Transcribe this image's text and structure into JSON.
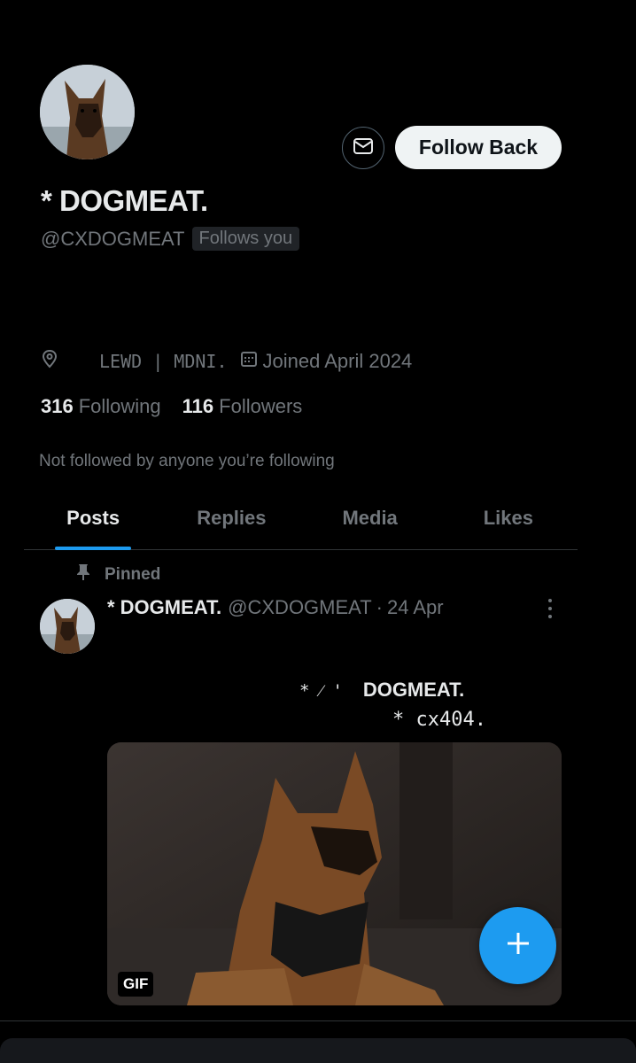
{
  "profile": {
    "display_name": "* DOGMEAT.",
    "handle": "@CXDOGMEAT",
    "follows_you": "Follows you",
    "location": "LEWD | MDNI.",
    "joined": "Joined April 2024",
    "following_count": "316",
    "following_label": "Following",
    "followers_count": "116",
    "followers_label": "Followers",
    "not_followed_text": "Not followed by anyone you’re following"
  },
  "actions": {
    "follow_back_label": "Follow Back"
  },
  "tabs": [
    {
      "label": "Posts",
      "active": true
    },
    {
      "label": "Replies",
      "active": false
    },
    {
      "label": "Media",
      "active": false
    },
    {
      "label": "Likes",
      "active": false
    }
  ],
  "post": {
    "pinned_label": "Pinned",
    "author_name": "* DOGMEAT.",
    "author_handle": "@CXDOGMEAT",
    "separator": "·",
    "date": "24 Apr",
    "line1_symbols": "* ⁄ '  ",
    "line1_name": "DOGMEAT.",
    "line2": "* cx404.",
    "media_badge": "GIF"
  },
  "colors": {
    "background": "#000000",
    "accent": "#1d9bf0",
    "primary_text": "#e7e9ea",
    "secondary_text": "#71767b"
  },
  "icons": [
    "mail-icon",
    "location-icon",
    "calendar-icon",
    "pin-icon",
    "more-icon",
    "plus-icon"
  ]
}
